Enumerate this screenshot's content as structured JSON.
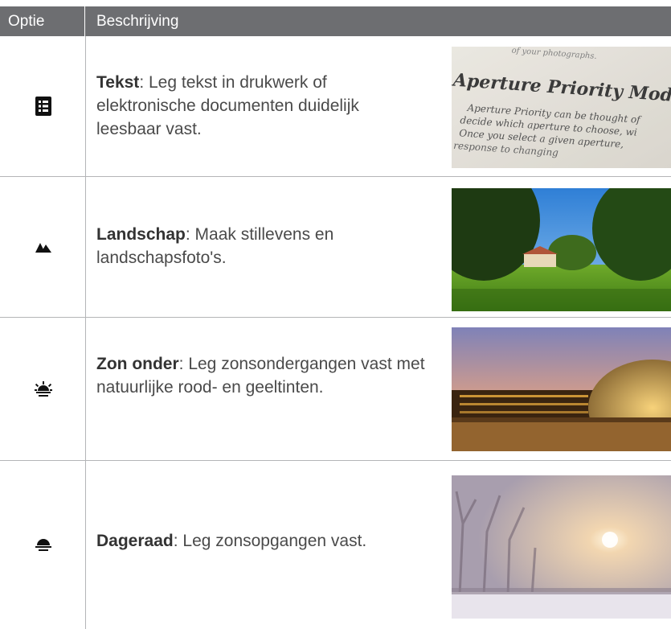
{
  "header": {
    "option_label": "Optie",
    "description_label": "Beschrijving"
  },
  "rows": [
    {
      "name": "Tekst",
      "description": ": Leg tekst in drukwerk of elektronische documenten duidelijk leesbaar vast.",
      "icon": "document-list-icon"
    },
    {
      "name": "Landschap",
      "description": ": Maak stillevens en landschapsfoto's.",
      "icon": "mountains-icon"
    },
    {
      "name": "Zon onder",
      "description": ": Leg zonsondergangen vast met natuurlijke rood- en geeltinten.",
      "icon": "sunset-icon"
    },
    {
      "name": "Dageraad",
      "description": ": Leg zonsopgangen vast.",
      "icon": "sunrise-icon"
    }
  ],
  "photo_text": {
    "top_line": "of your photographs.",
    "heading": "Aperture Priority Mode",
    "line1": "Aperture Priority can be thought of",
    "line2": "decide which aperture to choose, wi",
    "line3": "Once you select a given aperture,",
    "line4": "response to changing"
  }
}
